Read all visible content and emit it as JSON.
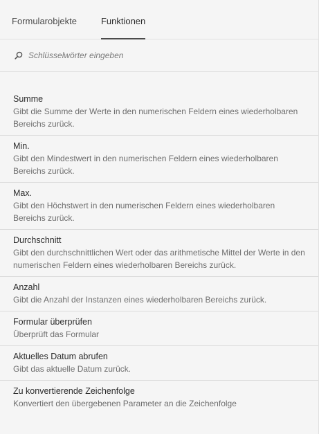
{
  "tabs": [
    {
      "label": "Formularobjekte",
      "active": false
    },
    {
      "label": "Funktionen",
      "active": true
    }
  ],
  "search": {
    "icon": "search-icon",
    "placeholder": "Schlüsselwörter eingeben",
    "value": ""
  },
  "functions": [
    {
      "title": "Summe",
      "description": "Gibt die Summe der Werte in den numerischen Feldern eines wiederholbaren Bereichs zurück."
    },
    {
      "title": "Min.",
      "description": "Gibt den Mindestwert in den numerischen Feldern eines wiederholbaren Bereichs zurück."
    },
    {
      "title": "Max.",
      "description": "Gibt den Höchstwert in den numerischen Feldern eines wiederholbaren Bereichs zurück."
    },
    {
      "title": "Durchschnitt",
      "description": "Gibt den durchschnittlichen Wert oder das arithmetische Mittel der Werte in den numerischen Feldern eines wiederholbaren Bereichs zurück."
    },
    {
      "title": "Anzahl",
      "description": "Gibt die Anzahl der Instanzen eines wiederholbaren Bereichs zurück."
    },
    {
      "title": "Formular überprüfen",
      "description": "Überprüft das Formular"
    },
    {
      "title": "Aktuelles Datum abrufen",
      "description": "Gibt das aktuelle Datum zurück."
    },
    {
      "title": "Zu konvertierende Zeichenfolge",
      "description": "Konvertiert den übergebenen Parameter an die Zeichenfolge"
    }
  ]
}
